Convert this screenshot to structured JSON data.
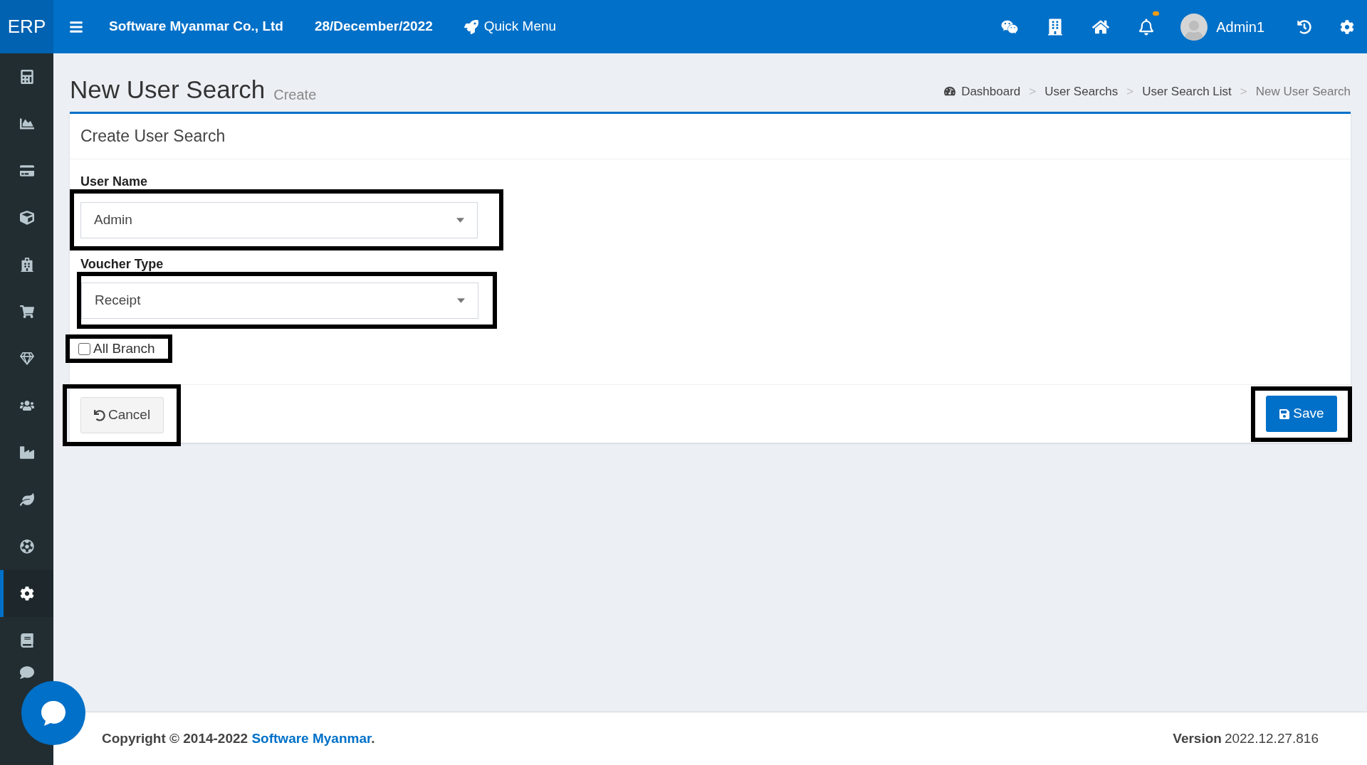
{
  "topbar": {
    "brand": "ERP",
    "company": "Software Myanmar Co., Ltd",
    "date": "28/December/2022",
    "quick_menu": "Quick Menu",
    "user": "Admin1",
    "notification_dot": true
  },
  "sidebar": {
    "items": [
      {
        "kind": "calculator",
        "selected": false
      },
      {
        "kind": "chart",
        "selected": false
      },
      {
        "kind": "card",
        "selected": false
      },
      {
        "kind": "cube",
        "selected": false
      },
      {
        "kind": "hospital",
        "selected": false
      },
      {
        "kind": "cart",
        "selected": false
      },
      {
        "kind": "gem",
        "selected": false
      },
      {
        "kind": "users",
        "selected": false
      },
      {
        "kind": "factory",
        "selected": false
      },
      {
        "kind": "leaf",
        "selected": false
      },
      {
        "kind": "ball",
        "selected": false
      },
      {
        "kind": "settings",
        "selected": true
      },
      {
        "kind": "book",
        "selected": false
      },
      {
        "kind": "comment",
        "selected": false
      }
    ]
  },
  "page": {
    "title": "New User Search",
    "subtitle": "Create",
    "breadcrumb_separator": ">",
    "breadcrumb": [
      {
        "label": "Dashboard",
        "current": false
      },
      {
        "label": "User Searchs",
        "current": false
      },
      {
        "label": "User Search List",
        "current": false
      },
      {
        "label": "New User Search",
        "current": true
      }
    ]
  },
  "card": {
    "title": "Create User Search",
    "fields": [
      {
        "label": "User Name",
        "value": "Admin"
      },
      {
        "label": "Voucher Type",
        "value": "Receipt"
      }
    ],
    "checkbox": {
      "label": "All Branch",
      "checked": false
    },
    "buttons": [
      {
        "kind": "cancel",
        "label": "Cancel"
      },
      {
        "kind": "save",
        "label": "Save"
      }
    ]
  },
  "footer": {
    "copyright": "Copyright © 2014-2022",
    "link": "Software Myanmar",
    "link_suffix": ".",
    "version_label": "Version",
    "version": "2022.12.27.816"
  }
}
